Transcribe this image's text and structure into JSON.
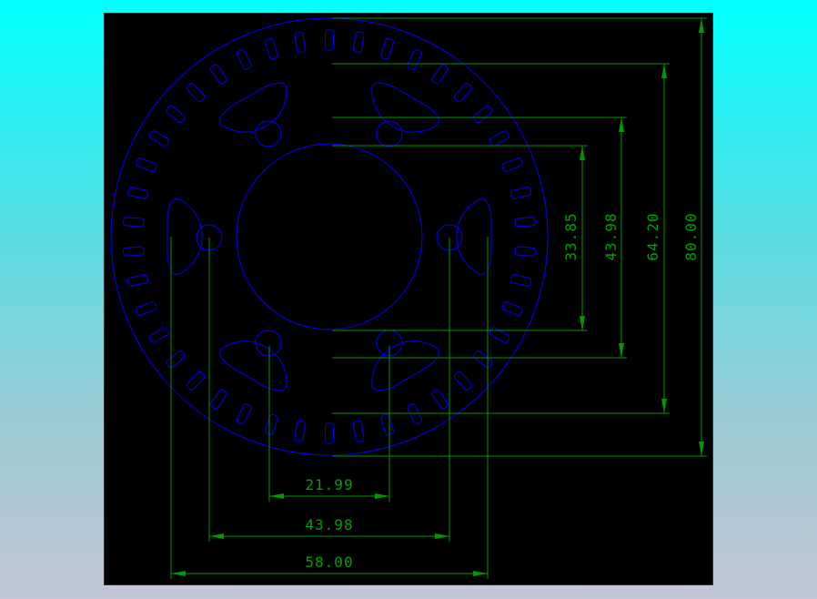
{
  "drawing": {
    "part": "sprocket-hub-with-slotted-ring",
    "colors": {
      "background": "#000000",
      "geometry": "#0000ff",
      "dimensions": "#009900",
      "page_gradient_top": "#00ffff",
      "page_gradient_bottom": "#c2c6d6"
    },
    "slot_count": 42,
    "bolt_hole_count": 6,
    "horizontal_dimensions": [
      {
        "label": "21.99",
        "value": 21.99
      },
      {
        "label": "43.98",
        "value": 43.98
      },
      {
        "label": "58.00",
        "value": 58.0
      }
    ],
    "vertical_dimensions": [
      {
        "label": "33.85",
        "value": 33.85
      },
      {
        "label": "43.98",
        "value": 43.98
      },
      {
        "label": "64.20",
        "value": 64.2
      },
      {
        "label": "80.00",
        "value": 80.0
      }
    ]
  }
}
